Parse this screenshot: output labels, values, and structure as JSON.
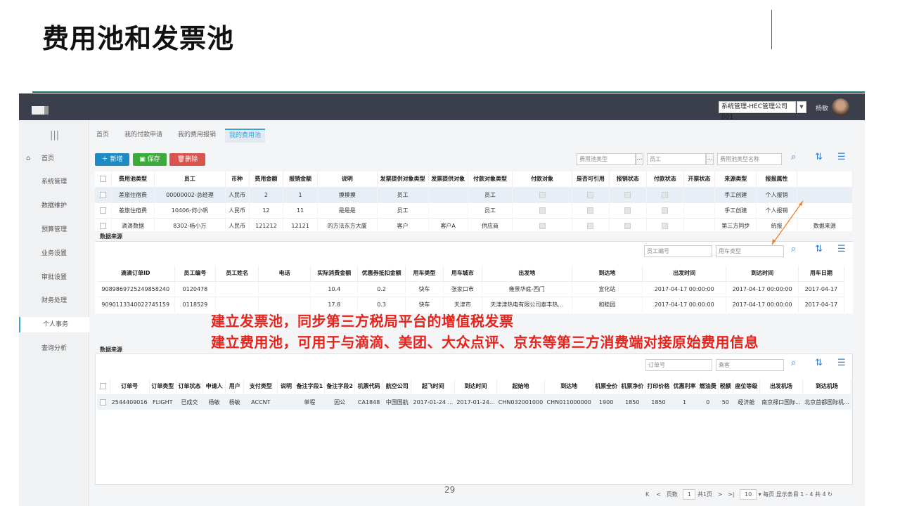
{
  "slide": {
    "title": "费用池和发票池",
    "page_number": "29"
  },
  "topbar": {
    "company": "系统管理-HEC管理公司001",
    "user": "杨敏"
  },
  "sidebar": {
    "menu_icon": "|||",
    "items": [
      "首页",
      "系统管理",
      "数据维护",
      "预算管理",
      "业务设置",
      "审批设置",
      "财务处理",
      "个人事务",
      "查询分析"
    ]
  },
  "tabs": [
    "首页",
    "我的付款申请",
    "我的费用报销",
    "我的费用池"
  ],
  "toolbar": {
    "add": "新增",
    "save": "保存",
    "delete": "删除"
  },
  "filters1": [
    "费用池类型",
    "员工",
    "费用池类型名称"
  ],
  "table1": {
    "headers": [
      "费用池类型",
      "员工",
      "币种",
      "费用金额",
      "报销金额",
      "说明",
      "发票提供对象类型",
      "发票提供对象",
      "付款对象类型",
      "付款对象",
      "是否可引用",
      "报销状态",
      "付款状态",
      "开票状态",
      "来源类型",
      "报报属性"
    ],
    "rows": [
      [
        "差旅住宿费",
        "00000002-总经理",
        "人民币",
        "2",
        "1",
        "摸摸摸",
        "员工",
        "",
        "员工",
        "",
        "",
        "",
        "",
        "",
        "手工创建",
        "个人报销"
      ],
      [
        "差旅住宿费",
        "10406-何小帆",
        "人民币",
        "12",
        "11",
        "是是是",
        "员工",
        "",
        "员工",
        "",
        "",
        "",
        "",
        "",
        "手工创建",
        "个人报销"
      ],
      [
        "滴滴数据",
        "8302-杨小万",
        "人民币",
        "121212",
        "12121",
        "的方法东方大厦",
        "客户",
        "客户A",
        "供应商",
        "",
        "",
        "",
        "",
        "",
        "第三方同步",
        "统报",
        "数据来源"
      ]
    ]
  },
  "section2": {
    "label": "数据来源",
    "filters": [
      "员工编号",
      "用车类型"
    ]
  },
  "table2": {
    "headers": [
      "滴滴订单ID",
      "员工编号",
      "员工姓名",
      "电话",
      "实际消费金额",
      "优惠券抵扣金额",
      "用车类型",
      "用车城市",
      "出发地",
      "到达地",
      "出发时间",
      "到达时间",
      "用车日期"
    ],
    "rows": [
      [
        "9089869725249858240",
        "0120478",
        "",
        "",
        "10.4",
        "0.2",
        "快车",
        "张家口市",
        "雍景华庭-西门",
        "宣化站",
        "2017-04-17 00:00:00",
        "2017-04-17 00:00:00",
        "2017-04-17"
      ],
      [
        "9090113340022745159",
        "0118529",
        "",
        "",
        "17.8",
        "0.3",
        "快车",
        "天津市",
        "天津津热电有限公司泰丰热...",
        "和睦园",
        "2017-04-17 00:00:00",
        "2017-04-17 00:00:00",
        "2017-04-17"
      ]
    ]
  },
  "annotations": [
    "建立发票池，同步第三方税局平台的增值税发票",
    "建立费用池，可用于与滴滴、美团、大众点评、京东等第三方消费端对接原始费用信息"
  ],
  "section3": {
    "label": "数据来源",
    "filters": [
      "订单号",
      "乘客"
    ]
  },
  "table3": {
    "headers": [
      "订单号",
      "订单类型",
      "订单状态",
      "申请人",
      "用户",
      "支付类型",
      "说明",
      "备注字段1",
      "备注字段2",
      "机票代码",
      "航空公司",
      "起飞时间",
      "到达时间",
      "起始地",
      "到达地",
      "机票全价",
      "机票净价",
      "打印价格",
      "优惠利率",
      "燃油费",
      "税额",
      "座位等级",
      "出发机场",
      "到达机场"
    ],
    "rows": [
      [
        "2544409016",
        "FLIGHT",
        "已成交",
        "杨敏",
        "杨敏",
        "ACCNT",
        "",
        "单程",
        "因公",
        "CA1848",
        "中国国航",
        "2017-01-24 ...",
        "2017-01-24...",
        "CHN032001000",
        "CHN011000000",
        "1900",
        "1850",
        "1850",
        "1",
        "0",
        "50",
        "经济舱",
        "南京禄口国际...",
        "北京首都国际机..."
      ]
    ]
  },
  "pager": {
    "page_label": "页数",
    "page": "1",
    "total_pages": "共1页",
    "per_page": "10",
    "summary": "每页 显示条目 1 - 4 共 4"
  },
  "colors": {
    "accent": "#3aa3d6",
    "add": "#1e8bc3",
    "save": "#3cab3c",
    "delete": "#d9534f",
    "annotation": "#e8231c"
  }
}
